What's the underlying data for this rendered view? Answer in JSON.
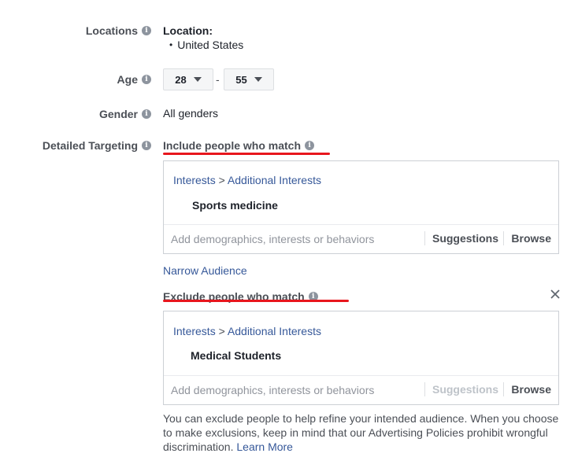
{
  "locations": {
    "label": "Locations",
    "heading": "Location:",
    "items": [
      "United States"
    ]
  },
  "age": {
    "label": "Age",
    "min": "28",
    "max": "55",
    "separator": "-"
  },
  "gender": {
    "label": "Gender",
    "value": "All genders"
  },
  "detailed_targeting": {
    "label": "Detailed Targeting",
    "include": {
      "title": "Include people who match",
      "path_category": "Interests",
      "path_separator": ">",
      "path_subcategory": "Additional Interests",
      "item": "Sports medicine",
      "placeholder": "Add demographics, interests or behaviors",
      "suggestions_label": "Suggestions",
      "browse_label": "Browse"
    },
    "narrow_label": "Narrow Audience",
    "exclude": {
      "title": "Exclude people who match",
      "path_category": "Interests",
      "path_separator": ">",
      "path_subcategory": "Additional Interests",
      "item": "Medical Students",
      "placeholder": "Add demographics, interests or behaviors",
      "suggestions_label": "Suggestions",
      "browse_label": "Browse"
    },
    "note_text": "You can exclude people to help refine your intended audience. When you choose to make exclusions, keep in mind that our Advertising Policies prohibit wrongful discrimination.",
    "learn_more": "Learn More"
  },
  "colors": {
    "highlight_underline": "#e8161d",
    "link": "#365899"
  }
}
